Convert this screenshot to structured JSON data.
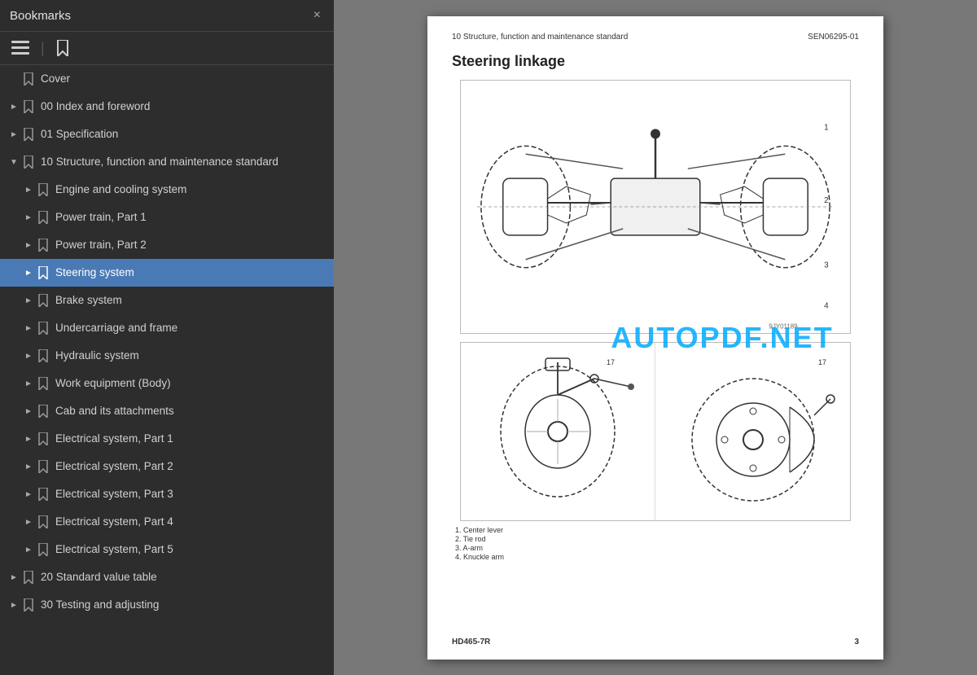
{
  "sidebar": {
    "title": "Bookmarks",
    "close_label": "×",
    "toolbar": {
      "list_icon": "☰",
      "bookmark_icon": "🔖"
    },
    "items": [
      {
        "id": "cover",
        "label": "Cover",
        "level": 0,
        "expand": false,
        "has_arrow": false,
        "active": false
      },
      {
        "id": "index",
        "label": "00 Index and foreword",
        "level": 0,
        "expand": false,
        "has_arrow": true,
        "active": false
      },
      {
        "id": "spec",
        "label": "01 Specification",
        "level": 0,
        "expand": false,
        "has_arrow": true,
        "active": false
      },
      {
        "id": "structure",
        "label": "10 Structure, function and maintenance standard",
        "level": 0,
        "expand": true,
        "has_arrow": true,
        "active": false,
        "open": true
      },
      {
        "id": "engine",
        "label": "Engine and cooling system",
        "level": 1,
        "expand": false,
        "has_arrow": true,
        "active": false
      },
      {
        "id": "powertrain1",
        "label": "Power train, Part 1",
        "level": 1,
        "expand": false,
        "has_arrow": true,
        "active": false
      },
      {
        "id": "powertrain2",
        "label": "Power train, Part 2",
        "level": 1,
        "expand": false,
        "has_arrow": true,
        "active": false
      },
      {
        "id": "steering",
        "label": "Steering system",
        "level": 1,
        "expand": false,
        "has_arrow": true,
        "active": true
      },
      {
        "id": "brake",
        "label": "Brake system",
        "level": 1,
        "expand": false,
        "has_arrow": true,
        "active": false
      },
      {
        "id": "undercarriage",
        "label": "Undercarriage and frame",
        "level": 1,
        "expand": false,
        "has_arrow": true,
        "active": false
      },
      {
        "id": "hydraulic",
        "label": "Hydraulic system",
        "level": 1,
        "expand": false,
        "has_arrow": true,
        "active": false
      },
      {
        "id": "work",
        "label": "Work equipment (Body)",
        "level": 1,
        "expand": false,
        "has_arrow": true,
        "active": false
      },
      {
        "id": "cab",
        "label": "Cab and its attachments",
        "level": 1,
        "expand": false,
        "has_arrow": true,
        "active": false
      },
      {
        "id": "elec1",
        "label": "Electrical system, Part 1",
        "level": 1,
        "expand": false,
        "has_arrow": true,
        "active": false
      },
      {
        "id": "elec2",
        "label": "Electrical system, Part 2",
        "level": 1,
        "expand": false,
        "has_arrow": true,
        "active": false
      },
      {
        "id": "elec3",
        "label": "Electrical system, Part 3",
        "level": 1,
        "expand": false,
        "has_arrow": true,
        "active": false
      },
      {
        "id": "elec4",
        "label": "Electrical system, Part 4",
        "level": 1,
        "expand": false,
        "has_arrow": true,
        "active": false
      },
      {
        "id": "elec5",
        "label": "Electrical system, Part 5",
        "level": 1,
        "expand": false,
        "has_arrow": true,
        "active": false
      },
      {
        "id": "standard",
        "label": "20 Standard value table",
        "level": 0,
        "expand": false,
        "has_arrow": true,
        "active": false
      },
      {
        "id": "testing",
        "label": "30 Testing and adjusting",
        "level": 0,
        "expand": false,
        "has_arrow": true,
        "active": false
      }
    ]
  },
  "page": {
    "header_left": "10 Structure, function and maintenance standard",
    "header_right": "SEN06295-01",
    "main_title": "Steering linkage",
    "watermark": "AUTOPDF.NET",
    "image_code": "9JY01189",
    "legend": [
      "1.   Center lever",
      "2.   Tie rod",
      "3.   A-arm",
      "4.   Knuckle arm"
    ],
    "footer_left": "HD465-7R",
    "footer_right": "3"
  }
}
